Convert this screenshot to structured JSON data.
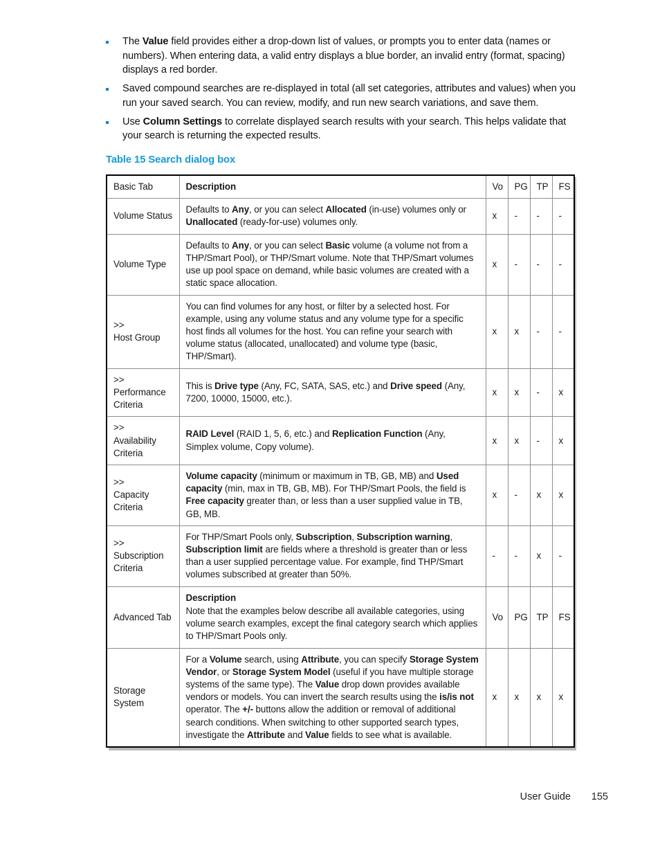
{
  "body_bullets": [
    {
      "id": "value-field",
      "runs": [
        {
          "t": "The ",
          "b": false
        },
        {
          "t": "Value",
          "b": true
        },
        {
          "t": " field provides either a drop-down list of values, or prompts you to enter data (names or numbers). When entering data, a valid entry displays a blue border, an invalid entry (format, spacing) displays a red border.",
          "b": false
        }
      ]
    },
    {
      "id": "saved-compound-searches",
      "runs": [
        {
          "t": "Saved compound searches are re-displayed in total (all set categories, attributes and values) when you run your saved search. You can review, modify, and run new search variations, and save them.",
          "b": false
        }
      ]
    },
    {
      "id": "column-settings",
      "runs": [
        {
          "t": "Use ",
          "b": false
        },
        {
          "t": "Column Settings",
          "b": true
        },
        {
          "t": " to correlate displayed search results with your search. This helps validate that your search is returning the expected results.",
          "b": false
        }
      ]
    }
  ],
  "table": {
    "caption": "Table 15 Search dialog box",
    "caption_color": "#149cd6",
    "bullet_color": "#1d7fc4",
    "columns": [
      "Basic Tab",
      "Description",
      "Vo",
      "PG",
      "TP",
      "FS"
    ],
    "rows": [
      {
        "kind": "header",
        "label": "Basic Tab",
        "desc_runs": [
          {
            "t": "Description",
            "b": true
          }
        ],
        "marks": [
          "Vo",
          "PG",
          "TP",
          "FS"
        ]
      },
      {
        "kind": "data",
        "label_prefix": "",
        "label": "Volume Status",
        "desc_runs": [
          {
            "t": "Defaults to ",
            "b": false
          },
          {
            "t": "Any",
            "b": true
          },
          {
            "t": ", or you can select ",
            "b": false
          },
          {
            "t": "Allocated",
            "b": true
          },
          {
            "t": " (in-use) volumes only or ",
            "b": false
          },
          {
            "t": "Unallocated",
            "b": true
          },
          {
            "t": " (ready-for-use) volumes only.",
            "b": false
          }
        ],
        "marks": [
          "x",
          "-",
          "-",
          "-"
        ]
      },
      {
        "kind": "data",
        "label_prefix": "",
        "label": "Volume Type",
        "desc_runs": [
          {
            "t": "Defaults to ",
            "b": false
          },
          {
            "t": "Any",
            "b": true
          },
          {
            "t": ", or you can select ",
            "b": false
          },
          {
            "t": "Basic",
            "b": true
          },
          {
            "t": " volume (a volume not from a THP/Smart Pool), or THP/Smart volume. Note that THP/Smart volumes use up pool space on demand, while basic volumes are created with a static space allocation.",
            "b": false
          }
        ],
        "marks": [
          "x",
          "-",
          "-",
          "-"
        ]
      },
      {
        "kind": "data",
        "label_prefix": ">>",
        "label": "Host Group",
        "desc_runs": [
          {
            "t": "You can find volumes for any host, or filter by a selected host. For example, using any volume status and any volume type for a specific host finds all volumes for the host. You can refine your search with volume status (allocated, unallocated) and volume type (basic, THP/Smart).",
            "b": false
          }
        ],
        "marks": [
          "x",
          "x",
          "-",
          "-"
        ]
      },
      {
        "kind": "data",
        "label_prefix": ">>",
        "label": "Performance Criteria",
        "desc_runs": [
          {
            "t": "This is ",
            "b": false
          },
          {
            "t": "Drive type",
            "b": true
          },
          {
            "t": " (Any, FC, SATA, SAS, etc.) and ",
            "b": false
          },
          {
            "t": "Drive speed",
            "b": true
          },
          {
            "t": " (Any, 7200, 10000, 15000, etc.).",
            "b": false
          }
        ],
        "marks": [
          "x",
          "x",
          "-",
          "x"
        ]
      },
      {
        "kind": "data",
        "label_prefix": ">>",
        "label": "Availability Criteria",
        "desc_runs": [
          {
            "t": "RAID Level",
            "b": true
          },
          {
            "t": " (RAID 1, 5, 6, etc.) and ",
            "b": false
          },
          {
            "t": "Replication Function",
            "b": true
          },
          {
            "t": " (Any, Simplex volume, Copy volume).",
            "b": false
          }
        ],
        "marks": [
          "x",
          "x",
          "-",
          "x"
        ]
      },
      {
        "kind": "data",
        "label_prefix": ">>",
        "label": "Capacity Criteria",
        "desc_runs": [
          {
            "t": "Volume capacity",
            "b": true
          },
          {
            "t": " (minimum or maximum in TB, GB, MB) and ",
            "b": false
          },
          {
            "t": "Used capacity",
            "b": true
          },
          {
            "t": " (min, max in TB, GB, MB). For THP/Smart Pools, the field is ",
            "b": false
          },
          {
            "t": "Free capacity",
            "b": true
          },
          {
            "t": " greater than, or less than a user supplied value in TB, GB, MB.",
            "b": false
          }
        ],
        "marks": [
          "x",
          "-",
          "x",
          "x"
        ]
      },
      {
        "kind": "data",
        "label_prefix": ">>",
        "label": "Subscription Criteria",
        "desc_runs": [
          {
            "t": "For THP/Smart Pools only, ",
            "b": false
          },
          {
            "t": "Subscription",
            "b": true
          },
          {
            "t": ", ",
            "b": false
          },
          {
            "t": "Subscription warning",
            "b": true
          },
          {
            "t": ", ",
            "b": false
          },
          {
            "t": "Subscription limit",
            "b": true
          },
          {
            "t": " are fields where a threshold is greater than or less than a user supplied percentage value. For example, find THP/Smart volumes subscribed at greater than 50%.",
            "b": false
          }
        ],
        "marks": [
          "-",
          "-",
          "x",
          "-"
        ]
      },
      {
        "kind": "header",
        "label": "Advanced Tab",
        "desc_heading": "Description",
        "desc_runs": [
          {
            "t": "Note that the examples below describe all available categories, using volume search examples, except the final category search which applies to THP/Smart Pools only.",
            "b": false
          }
        ],
        "marks": [
          "Vo",
          "PG",
          "TP",
          "FS"
        ]
      },
      {
        "kind": "data",
        "label_prefix": "",
        "label": "Storage System",
        "desc_runs": [
          {
            "t": "For a ",
            "b": false
          },
          {
            "t": "Volume",
            "b": true
          },
          {
            "t": " search, using ",
            "b": false
          },
          {
            "t": "Attribute",
            "b": true
          },
          {
            "t": ", you can specify ",
            "b": false
          },
          {
            "t": "Storage System Vendor",
            "b": true
          },
          {
            "t": ", or ",
            "b": false
          },
          {
            "t": "Storage System Model",
            "b": true
          },
          {
            "t": " (useful if you have multiple storage systems of the same type). The ",
            "b": false
          },
          {
            "t": "Value",
            "b": true
          },
          {
            "t": " drop down provides available vendors or models. You can invert the search results using the ",
            "b": false
          },
          {
            "t": "is/is not",
            "b": true
          },
          {
            "t": " operator. The ",
            "b": false
          },
          {
            "t": "+/-",
            "b": true
          },
          {
            "t": " buttons allow the addition or removal of additional search conditions. When switching to other supported search types, investigate the ",
            "b": false
          },
          {
            "t": "Attribute",
            "b": true
          },
          {
            "t": " and ",
            "b": false
          },
          {
            "t": "Value",
            "b": true
          },
          {
            "t": " fields to see what is available.",
            "b": false
          }
        ],
        "marks": [
          "x",
          "x",
          "x",
          "x"
        ]
      }
    ]
  },
  "footer": {
    "guide_label": "User Guide",
    "page_number": "155"
  }
}
